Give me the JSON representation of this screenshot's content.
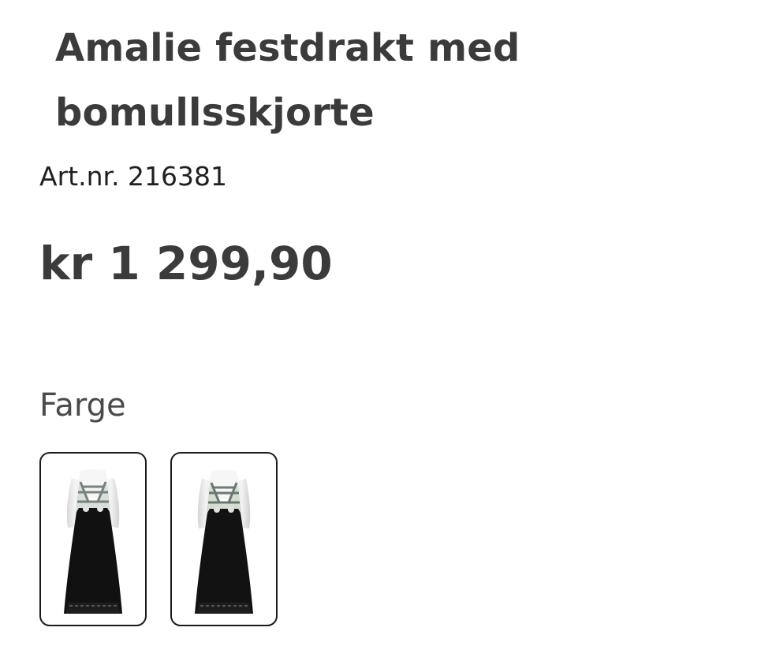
{
  "product": {
    "title": "Amalie festdrakt med bomullsskjorte",
    "article_number": "Art.nr. 216381",
    "price": "kr 1 299,90"
  },
  "color_selector": {
    "label": "Farge",
    "options": [
      {
        "name": "color-option-1",
        "vest_color": "#d7ddd7",
        "pattern_color": "#6a756f",
        "skirt_color": "#111111"
      },
      {
        "name": "color-option-2",
        "vest_color": "#d5ddd3",
        "pattern_color": "#5e6c64",
        "skirt_color": "#121212"
      }
    ]
  }
}
